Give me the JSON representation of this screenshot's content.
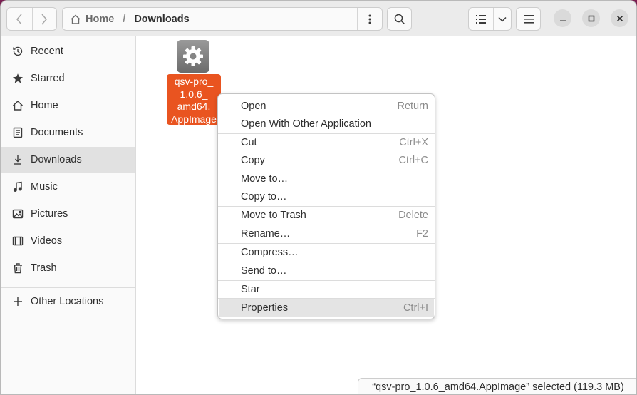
{
  "path": {
    "home": "Home",
    "current": "Downloads"
  },
  "sidebar": {
    "items": [
      {
        "label": "Recent",
        "icon": "clock-icon"
      },
      {
        "label": "Starred",
        "icon": "star-icon"
      },
      {
        "label": "Home",
        "icon": "home-icon"
      },
      {
        "label": "Documents",
        "icon": "document-icon"
      },
      {
        "label": "Downloads",
        "icon": "download-icon",
        "active": true
      },
      {
        "label": "Music",
        "icon": "music-icon"
      },
      {
        "label": "Pictures",
        "icon": "picture-icon"
      },
      {
        "label": "Videos",
        "icon": "video-icon"
      },
      {
        "label": "Trash",
        "icon": "trash-icon"
      }
    ],
    "other": {
      "label": "Other Locations",
      "icon": "plus-icon"
    }
  },
  "file": {
    "name": "qsv-pro_\n1.0.6_\namd64.\nAppImage",
    "icon": "gear-icon",
    "selected_color": "#e95420"
  },
  "context_menu": {
    "items": [
      {
        "label": "Open",
        "accel": "Return"
      },
      {
        "label": "Open With Other Application",
        "accel": ""
      },
      {
        "label": "Cut",
        "accel": "Ctrl+X"
      },
      {
        "label": "Copy",
        "accel": "Ctrl+C"
      },
      {
        "label": "Move to…",
        "accel": ""
      },
      {
        "label": "Copy to…",
        "accel": ""
      },
      {
        "label": "Move to Trash",
        "accel": "Delete"
      },
      {
        "label": "Rename…",
        "accel": "F2"
      },
      {
        "label": "Compress…",
        "accel": ""
      },
      {
        "label": "Send to…",
        "accel": ""
      },
      {
        "label": "Star",
        "accel": ""
      },
      {
        "label": "Properties",
        "accel": "Ctrl+I",
        "hover": true
      }
    ]
  },
  "status": {
    "text": "“qsv-pro_1.0.6_amd64.AppImage” selected  (119.3 MB)"
  }
}
